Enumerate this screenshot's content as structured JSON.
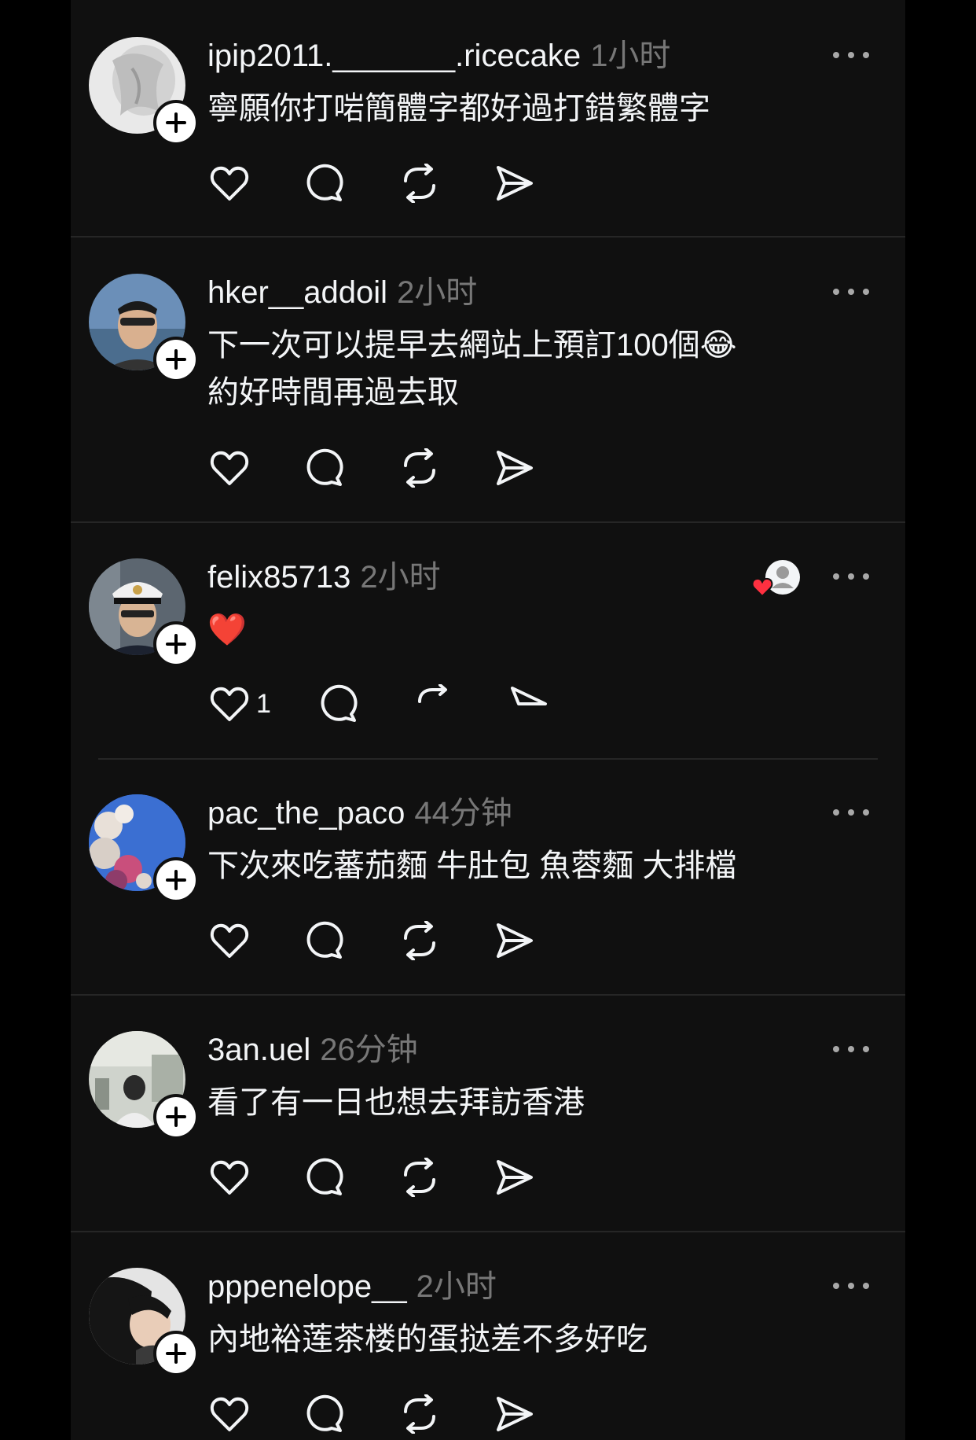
{
  "comments": [
    {
      "username": "ipip2011._______.ricecake",
      "time": "1小时",
      "lines": [
        "寧願你打啱簡體字都好過打錯繁體字",
        ""
      ],
      "likes": ""
    },
    {
      "username": "hker__addoil",
      "time": "2小时",
      "lines": [
        "下一次可以提早去網站上預訂100個😂",
        "約好時間再過去取"
      ],
      "likes": ""
    },
    {
      "username": "felix85713",
      "time": "2小时",
      "lines": [
        "❤️",
        ""
      ],
      "likes": "1"
    },
    {
      "username": "pac_the_paco",
      "time": "44分钟",
      "lines": [
        "下次來吃蕃茄麵 牛肚包 魚蓉麵 大排檔",
        ""
      ],
      "likes": ""
    },
    {
      "username": "3an.uel",
      "time": "26分钟",
      "lines": [
        "看了有一日也想去拜訪香港",
        ""
      ],
      "likes": ""
    },
    {
      "username": "pppenelope__",
      "time": "2小时",
      "lines": [
        "內地裕莲茶楼的蛋挞差不多好吃",
        ""
      ],
      "likes": ""
    }
  ],
  "colors": {
    "background": "#101010",
    "text_primary": "#f3f5f7",
    "text_secondary": "#777777",
    "divider": "#262626",
    "like_red": "#ff3040"
  },
  "icons": [
    "heart-icon",
    "comment-icon",
    "repost-icon",
    "share-icon",
    "more-icon",
    "plus-icon",
    "liked-by-author-icon"
  ]
}
